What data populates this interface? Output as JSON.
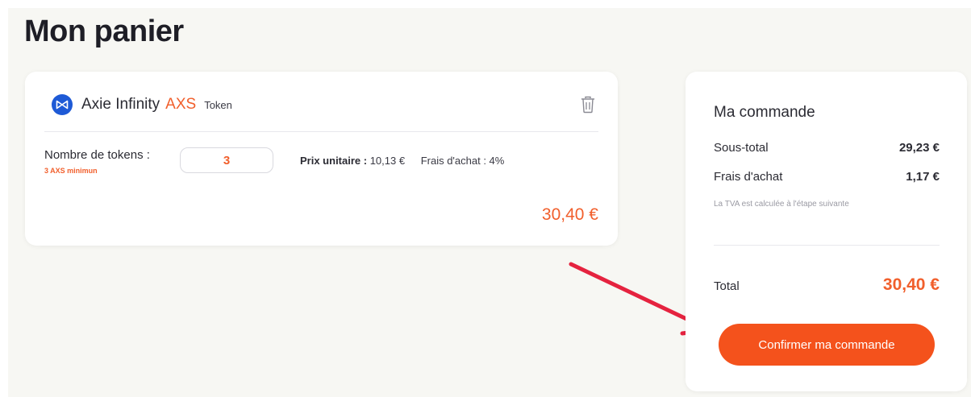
{
  "page": {
    "title": "Mon panier"
  },
  "cart_item": {
    "name": "Axie Infinity",
    "symbol": "AXS",
    "type": "Token",
    "quantity_label": "Nombre de tokens :",
    "minimum_note": "3 AXS minimun",
    "quantity": "3",
    "unit_price_label": "Prix unitaire :",
    "unit_price": "10,13 €",
    "fees": "Frais d'achat : 4%",
    "line_total": "30,40 €"
  },
  "order": {
    "title": "Ma commande",
    "subtotal_label": "Sous-total",
    "subtotal": "29,23 €",
    "fees_label": "Frais d'achat",
    "fees": "1,17 €",
    "vat_note": "La TVA est calculée à l'étape suivante",
    "total_label": "Total",
    "total": "30,40 €",
    "confirm_label": "Confirmer ma commande"
  },
  "icons": {
    "token_logo": "axie-infinity-logo",
    "delete": "trash-icon",
    "annotation": "red-arrow"
  },
  "colors": {
    "accent": "#f15f2c",
    "button": "#f4521c",
    "logo_blue": "#1e5ad6",
    "arrow_red": "#e5233f"
  }
}
